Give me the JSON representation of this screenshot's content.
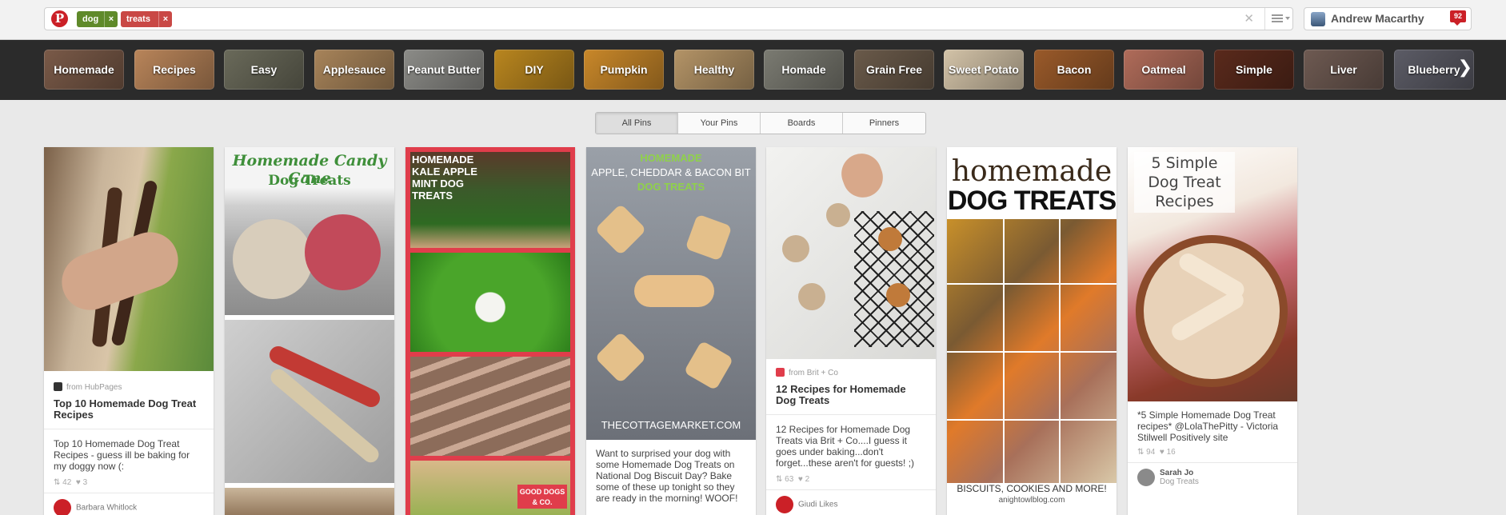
{
  "header": {
    "search_chips": [
      "dog",
      "treats"
    ],
    "chip_remove_symbol": "×",
    "clear_symbol": "✕",
    "user_name": "Andrew Macarthy",
    "notification_count": "92"
  },
  "categories": [
    {
      "label": "Homemade",
      "color": "#7a5a48"
    },
    {
      "label": "Recipes",
      "color": "#b9855a"
    },
    {
      "label": "Easy",
      "color": "#6a6a5a"
    },
    {
      "label": "Applesauce",
      "color": "#a8845a"
    },
    {
      "label": "Peanut Butter",
      "color": "#8c8c88"
    },
    {
      "label": "DIY",
      "color": "#b9861f"
    },
    {
      "label": "Pumpkin",
      "color": "#c9882a"
    },
    {
      "label": "Healthy",
      "color": "#b49467"
    },
    {
      "label": "Homade",
      "color": "#7b7b72"
    },
    {
      "label": "Grain Free",
      "color": "#6a5a4a"
    },
    {
      "label": "Sweet Potato",
      "color": "#d3c3a8"
    },
    {
      "label": "Bacon",
      "color": "#9a5a2a"
    },
    {
      "label": "Oatmeal",
      "color": "#b06c5a"
    },
    {
      "label": "Simple",
      "color": "#5a2a1c"
    },
    {
      "label": "Liver",
      "color": "#6e5a52"
    },
    {
      "label": "Blueberry",
      "color": "#5c5c66"
    }
  ],
  "category_next_symbol": "❯",
  "filter_tabs": [
    "All Pins",
    "Your Pins",
    "Boards",
    "Pinners"
  ],
  "pins": [
    {
      "source": "from HubPages",
      "title": "Top 10 Homemade Dog Treat Recipes",
      "description": "Top 10 Homemade Dog Treat Recipes - guess ill be baking for my doggy now (:",
      "repins": "42",
      "likes": "3",
      "pinner": "Barbara Whitlock"
    },
    {
      "overlay_line1": "Homemade Candy Cane",
      "overlay_line2": "Dog Treats"
    },
    {
      "overlay_text": "HOMEMADE KALE APPLE MINT DOG TREATS",
      "badge_text": "GOOD DOGS & CO."
    },
    {
      "overlay_line1": "HOMEMADE",
      "overlay_line2": "APPLE, CHEDDAR & BACON BIT",
      "overlay_line3": "DOG TREATS",
      "watermark": "THECOTTAGEMARKET.COM",
      "description": "Want to surprised your dog with some Homemade Dog Treats on National Dog Biscuit Day? Bake some of these up tonight so they are ready in the morning! WOOF!"
    },
    {
      "source": "from Brit + Co",
      "title": "12 Recipes for Homemade Dog Treats",
      "description": "12 Recipes for Homemade Dog Treats via Brit + Co....I guess it goes under baking...don't forget...these aren't for guests! ;)",
      "repins": "63",
      "likes": "2",
      "pinner": "Giudi Likes"
    },
    {
      "overlay_line1": "homemade",
      "overlay_line2": "DOG TREATS",
      "footer_line1": "BISCUITS, COOKIES AND MORE!",
      "footer_line2": "anightowlblog.com"
    },
    {
      "overlay_text": "5 Simple Dog Treat Recipes",
      "description": "*5 Simple Homemade Dog Treat recipes* @LolaThePitty - Victoria Stilwell Positively site",
      "repins": "94",
      "likes": "16",
      "pinner": "Sarah Jo",
      "board": "Dog Treats"
    }
  ]
}
